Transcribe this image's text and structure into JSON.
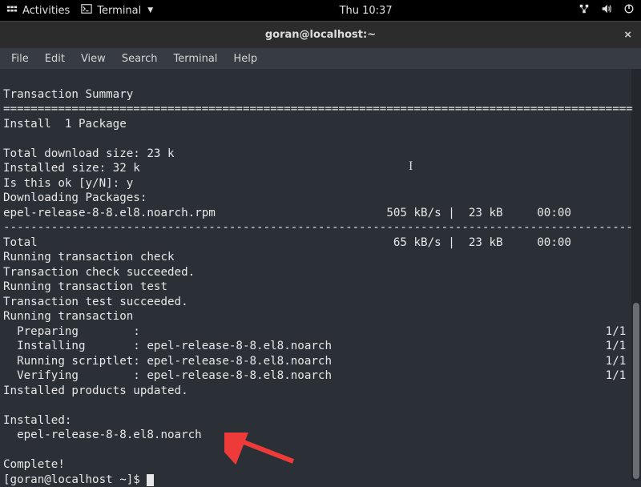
{
  "topbar": {
    "activities": "Activities",
    "app_label": "Terminal",
    "clock": "Thu 10:37"
  },
  "titlebar": {
    "title": "goran@localhost:~",
    "close_glyph": "×"
  },
  "menubar": {
    "items": [
      "File",
      "Edit",
      "View",
      "Search",
      "Terminal",
      "Help"
    ]
  },
  "terminal": {
    "lines": [
      "",
      "Transaction Summary",
      "============================================================================================",
      "Install  1 Package",
      "",
      "Total download size: 23 k",
      "Installed size: 32 k",
      "Is this ok [y/N]: y",
      "Downloading Packages:",
      "epel-release-8-8.el8.noarch.rpm                         505 kB/s |  23 kB     00:00    ",
      "--------------------------------------------------------------------------------------------",
      "Total                                                    65 kB/s |  23 kB     00:00    ",
      "Running transaction check",
      "Transaction check succeeded.",
      "Running transaction test",
      "Transaction test succeeded.",
      "Running transaction",
      "  Preparing        :                                                                    1/1",
      "  Installing       : epel-release-8-8.el8.noarch                                        1/1",
      "  Running scriptlet: epel-release-8-8.el8.noarch                                        1/1",
      "  Verifying        : epel-release-8-8.el8.noarch                                        1/1",
      "Installed products updated.",
      "",
      "Installed:",
      "  epel-release-8-8.el8.noarch",
      "",
      "Complete!"
    ],
    "prompt": "[goran@localhost ~]$ "
  }
}
